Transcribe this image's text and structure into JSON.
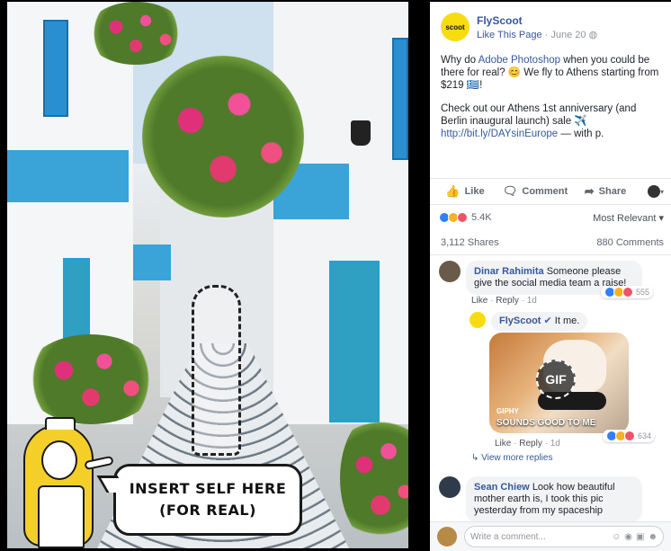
{
  "photo": {
    "bubble_line1": "INSERT SELF HERE",
    "bubble_line2": "(FOR REAL)"
  },
  "post": {
    "page_logo_text": "scoot",
    "page_name": "FlyScoot",
    "like_this_page": "Like This Page",
    "date": "June 20",
    "line1_prefix": "Why do ",
    "line1_link": "Adobe Photoshop",
    "line1_suffix": " when you could be there for real? 😊 We fly to Athens starting from $219 🇬🇷!",
    "line2_prefix": "Check out our Athens 1st anniversary (and Berlin inaugural launch) sale ✈️ ",
    "line2_link": "http://bit.ly/DAYsinEurope",
    "line2_suffix": " — with p."
  },
  "actions": {
    "like": "Like",
    "comment": "Comment",
    "share": "Share"
  },
  "reactions": {
    "count": "5.4K",
    "sort": "Most Relevant ▾",
    "shares": "3,112 Shares",
    "comments": "880 Comments"
  },
  "comments": [
    {
      "name": "Dinar Rahimita",
      "text": "Someone please give the social media team a raise!",
      "like": "Like",
      "reply": "Reply",
      "time": "1d",
      "reactions": "555"
    },
    {
      "name": "FlyScoot",
      "text": "It me.",
      "gif_badge": "GIF",
      "gif_caption": "SOUNDS GOOD TO ME",
      "gif_brand": "GIPHY",
      "like": "Like",
      "reply": "Reply",
      "time": "1d",
      "reactions": "634"
    },
    {
      "name": "Sean Chiew",
      "text": "Look how beautiful mother earth is, I took this pic yesterday from my spaceship"
    }
  ],
  "view_more": "↳ View more replies",
  "write_comment": {
    "placeholder": "Write a comment...",
    "icons": [
      "emoji-icon",
      "camera-icon",
      "gif-icon",
      "sticker-icon"
    ]
  },
  "colors": {
    "link": "#365899",
    "scoot_yellow": "#f7dc12",
    "like_blue": "#2e81f4"
  }
}
